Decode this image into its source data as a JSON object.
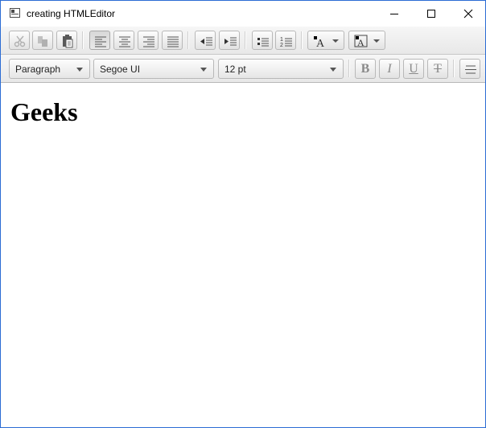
{
  "window": {
    "title": "creating HTMLEditor"
  },
  "toolbar1": {
    "buttons": [
      "cut-icon",
      "copy-icon",
      "paste-icon",
      "align-left-icon",
      "align-center-icon",
      "align-right-icon",
      "align-justify-icon",
      "outdent-icon",
      "indent-icon",
      "bullet-list-icon",
      "numbered-list-icon",
      "text-color-icon",
      "background-color-icon"
    ],
    "pressed": "align-left-icon"
  },
  "toolbar2": {
    "format": "Paragraph",
    "font_family": "Segoe UI",
    "font_size": "12 pt",
    "bold_label": "B",
    "italic_label": "I",
    "underline_label": "U",
    "strike_label": "T"
  },
  "editor": {
    "heading": "Geeks"
  },
  "colors": {
    "window_border": "#2b6cd4",
    "toolbar_bg": "#ececec",
    "text_color_swatch": "#000000"
  }
}
